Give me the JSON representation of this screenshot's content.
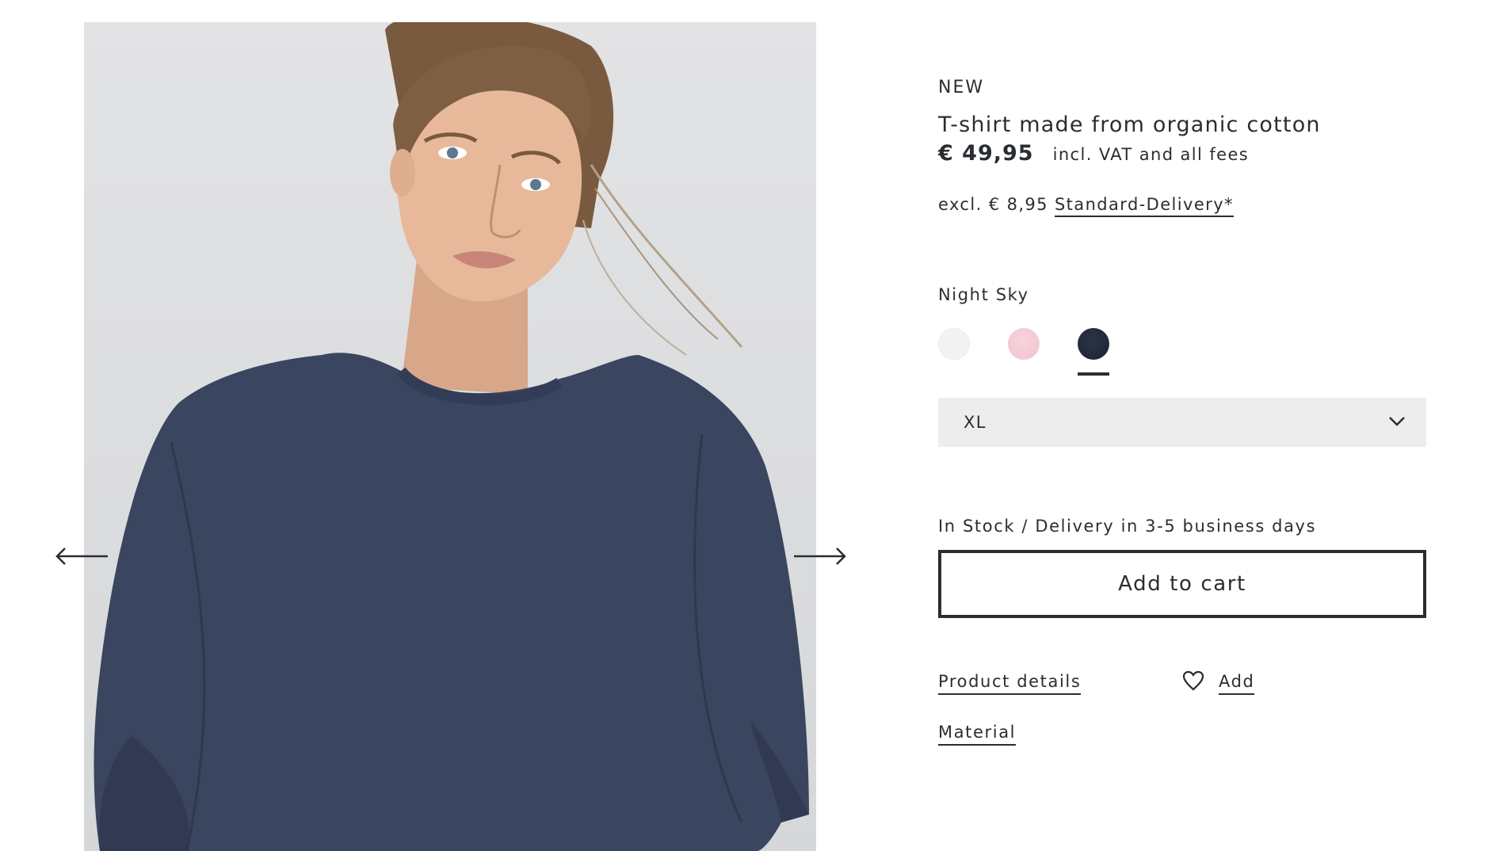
{
  "gallery": {
    "prev_icon": "arrow-left-icon",
    "next_icon": "arrow-right-icon"
  },
  "product": {
    "badge": "NEW",
    "title": "T-shirt made from organic cotton",
    "price": "€ 49,95",
    "vat_note": "incl. VAT and all fees",
    "shipping_prefix": "excl. € 8,95",
    "shipping_link": "Standard-Delivery*",
    "color_name": "Night Sky",
    "colors": [
      {
        "name": "white",
        "hex": "#f3f3f3"
      },
      {
        "name": "pink",
        "hex": "#f1c2cc"
      },
      {
        "name": "night-sky",
        "hex": "#1c2233",
        "selected": true
      }
    ],
    "size": "XL",
    "stock": "In Stock / Delivery in 3-5 business days",
    "add_to_cart": "Add to cart",
    "product_details": "Product details",
    "wishlist_label": "Add",
    "material": "Material"
  }
}
